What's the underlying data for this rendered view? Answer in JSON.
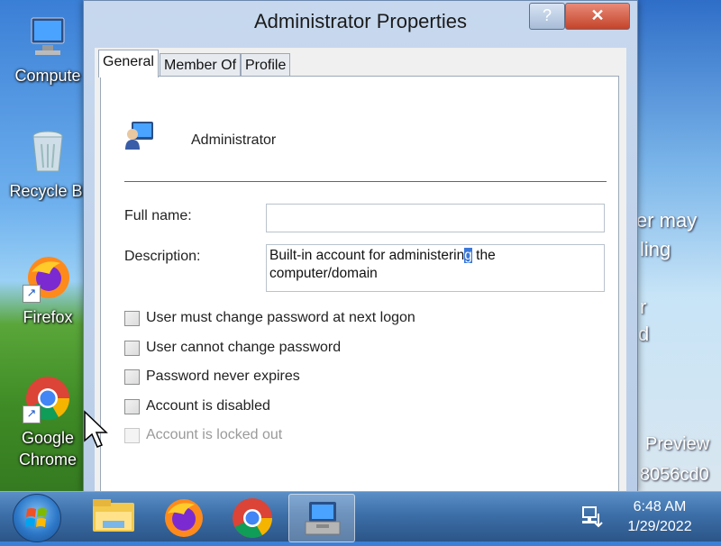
{
  "desktop": {
    "icons": [
      {
        "label": "Compute",
        "icon": "computer-icon"
      },
      {
        "label": "Recycle Bi",
        "icon": "recycle-bin-icon"
      },
      {
        "label": "Firefox",
        "icon": "firefox-icon"
      },
      {
        "label": "Google",
        "label2": "Chrome",
        "icon": "chrome-icon"
      }
    ],
    "wallpaper_fragments": [
      "er may",
      "ling",
      "r",
      "d",
      "Preview",
      "8056cd0"
    ]
  },
  "dialog": {
    "title": "Administrator Properties",
    "help_label": "?",
    "close_label": "✕",
    "tabs": [
      "General",
      "Member Of",
      "Profile"
    ],
    "active_tab": "General",
    "user_icon": "user-icon",
    "user_name": "Administrator",
    "full_name_label": "Full name:",
    "full_name_value": "",
    "description_label": "Description:",
    "description_before_sel": "Built-in account for administerin",
    "description_sel": "g",
    "description_after_sel": " the",
    "description_line2": "computer/domain",
    "checkboxes": [
      {
        "label": "User must change password at next logon",
        "checked": false,
        "enabled": true
      },
      {
        "label": "User cannot change password",
        "checked": false,
        "enabled": true
      },
      {
        "label": "Password never expires",
        "checked": false,
        "enabled": true
      },
      {
        "label": "Account is disabled",
        "checked": false,
        "enabled": true
      },
      {
        "label": "Account is locked out",
        "checked": false,
        "enabled": false
      }
    ]
  },
  "taskbar": {
    "apps": [
      "start-icon",
      "file-explorer-icon",
      "firefox-icon",
      "chrome-icon",
      "admin-tools-icon"
    ],
    "time": "6:48 AM",
    "date": "1/29/2022"
  },
  "colors": {
    "selection": "#3a78d8",
    "taskbar": "#3d6fa8",
    "close_button": "#c4442a"
  }
}
